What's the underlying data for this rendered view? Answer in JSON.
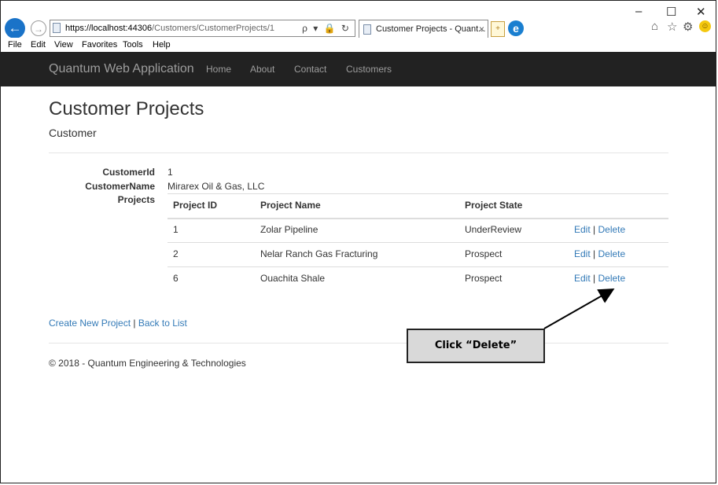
{
  "browser": {
    "url_host": "https://localhost:44306",
    "url_path": "/Customers/CustomerProjects/1",
    "address_actions": "ρ ▾ 🔒 ↻",
    "tab_title": "Customer Projects - Quant...",
    "tab_close": "×",
    "window_min": "–",
    "window_max": "☐",
    "window_close": "✕",
    "menu": [
      "File",
      "Edit",
      "View",
      "Favorites",
      "Tools",
      "Help"
    ],
    "icons": [
      "back-arrow-icon",
      "forward-arrow-icon",
      "home-icon",
      "favorites-star-icon",
      "settings-gear-icon",
      "feedback-smiley-icon"
    ]
  },
  "navbar": {
    "brand": "Quantum Web Application",
    "links": [
      "Home",
      "About",
      "Contact",
      "Customers"
    ]
  },
  "page": {
    "title": "Customer Projects",
    "subtitle": "Customer",
    "fields": {
      "customer_id_label": "CustomerId",
      "customer_id_value": "1",
      "customer_name_label": "CustomerName",
      "customer_name_value": "Mirarex Oil & Gas, LLC",
      "projects_label": "Projects"
    },
    "table": {
      "headers": [
        "Project ID",
        "Project Name",
        "Project State"
      ],
      "rows": [
        {
          "id": "1",
          "name": "Zolar Pipeline",
          "state": "UnderReview",
          "edit": "Edit",
          "sep": "|",
          "delete": "Delete"
        },
        {
          "id": "2",
          "name": "Nelar Ranch Gas Fracturing",
          "state": "Prospect",
          "edit": "Edit",
          "sep": "|",
          "delete": "Delete"
        },
        {
          "id": "6",
          "name": "Ouachita Shale",
          "state": "Prospect",
          "edit": "Edit",
          "sep": "|",
          "delete": "Delete"
        }
      ]
    },
    "links": {
      "create": "Create New Project",
      "sep": "|",
      "back": "Back to List"
    },
    "footer": "© 2018 - Quantum Engineering & Technologies"
  },
  "annotation": {
    "callout_text": "Click “Delete”"
  }
}
